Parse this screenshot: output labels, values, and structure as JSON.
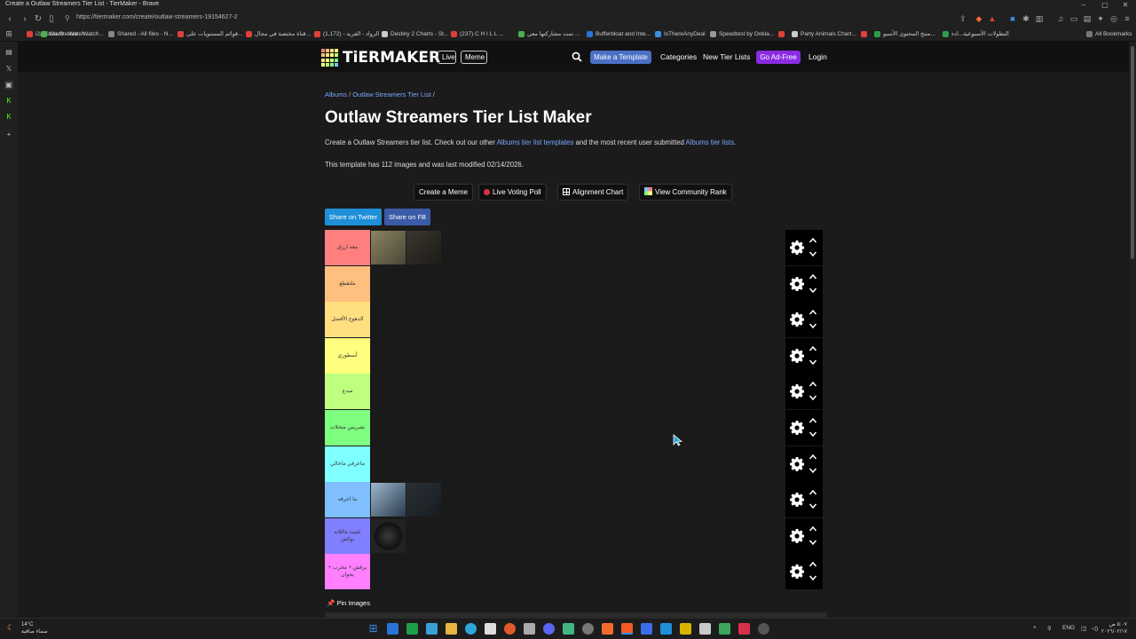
{
  "window": {
    "title": "Create a Outlaw Streamers Tier List - TierMaker - Brave",
    "controls": [
      "–",
      "▢",
      "✕"
    ]
  },
  "browser": {
    "url": "https://tiermaker.com/create/outlaw-streamers-19154627-2",
    "bookmarks": [
      {
        "label": "i2a Stream - Watch...",
        "color": "#e0403a"
      },
      {
        "label": "Shared - All files - N...",
        "color": "#888888"
      },
      {
        "label": "قوائم المستويات على...",
        "color": "#e0403a"
      },
      {
        "label": "قناة مختصة في مجال...",
        "color": "#e0403a"
      },
      {
        "label": "(1,172) - الرواد - الفريد",
        "color": "#e0403a"
      },
      {
        "label": "Destiny 2 Charts - St...",
        "color": "#cccccc"
      },
      {
        "label": "(237) C H I L L ...",
        "color": "#e0403a"
      },
      {
        "label": "تمت مشاركتها معي ...",
        "color": "#4caf50"
      },
      {
        "label": "Bufferbloat and Inte...",
        "color": "#2b73d6"
      },
      {
        "label": "IsThereAnyDeal",
        "color": "#3a8ee6"
      },
      {
        "label": "Speedtest by Ookla...",
        "color": "#999999"
      },
      {
        "label": "Party Animals Chart...",
        "color": "#cccccc"
      },
      {
        "label": "منتج المحتوى الأسبو...",
        "color": "#2e9e4a"
      },
      {
        "label": "البطولات الأسبوعية...ادء",
        "color": "#2e9e4a"
      }
    ],
    "all_bookmarks": "All Bookmarks"
  },
  "header": {
    "logo_text": "TiERMAKER",
    "live": "Live",
    "meme": "Meme",
    "make_template": "Make a Template",
    "categories": "Categories",
    "new_tier_lists": "New Tier Lists",
    "go_ad_free": "Go Ad-Free",
    "login": "Login",
    "colors": {
      "make_template_bg": "#4a6fc4",
      "ad_free_bg": "#8a2be2"
    }
  },
  "page": {
    "breadcrumb": {
      "albums": "Albums",
      "sep": "/",
      "current": "Outlaw Streamers Tier List",
      "trail": "/"
    },
    "title": "Outlaw Streamers Tier List Maker",
    "desc_prefix": "Create a Outlaw Streamers tier list. Check out our other",
    "desc_link1": "Albums tier list templates",
    "desc_mid": "and the most recent user submitted",
    "desc_link2": "Albums tier lists",
    "desc_end": ".",
    "info": "This template has 112 images and was last modified 02/14/2026."
  },
  "actions": {
    "create_meme": "Create a Meme",
    "voting_poll": "Live Voting Poll",
    "alignment_chart": "Alignment Chart",
    "community_rank": "View Community Rank"
  },
  "share": {
    "twitter": "Share on Twitter",
    "facebook": "Share on FB",
    "twitter_color": "#1e8fd8",
    "facebook_color": "#3b5ba8"
  },
  "tiers": [
    {
      "label": "معه ارزق",
      "color": "#ff7f7f",
      "items": 2
    },
    {
      "label": "ملتقطع",
      "color": "#ffbf7f",
      "items": 0
    },
    {
      "label": "الدهوج الأفضل",
      "color": "#ffdf7f",
      "items": 0
    },
    {
      "label": "أسطوري",
      "color": "#ffff7f",
      "items": 0
    },
    {
      "label": "مبدع",
      "color": "#bfff7f",
      "items": 0
    },
    {
      "label": "نشريس متحلات",
      "color": "#7fff7f",
      "items": 0
    },
    {
      "label": "ماعرفي ماخالي",
      "color": "#7fffff",
      "items": 0
    },
    {
      "label": "ما اعرفه",
      "color": "#7fbfff",
      "items": 2
    },
    {
      "label": "يلبيت ماللانه بوكش",
      "color": "#7f7fff",
      "items": 1
    },
    {
      "label": "برقش + مخرب + يجوان",
      "color": "#ff7fff",
      "items": 0
    }
  ],
  "pin_images": "Pin Images",
  "taskbar": {
    "weather_temp": "14°C",
    "weather_desc": "سماء صافية",
    "lang": "ENG",
    "time": "٥:٠٧ ص",
    "date": "٢٠٢٦/٠٢/١٧"
  }
}
